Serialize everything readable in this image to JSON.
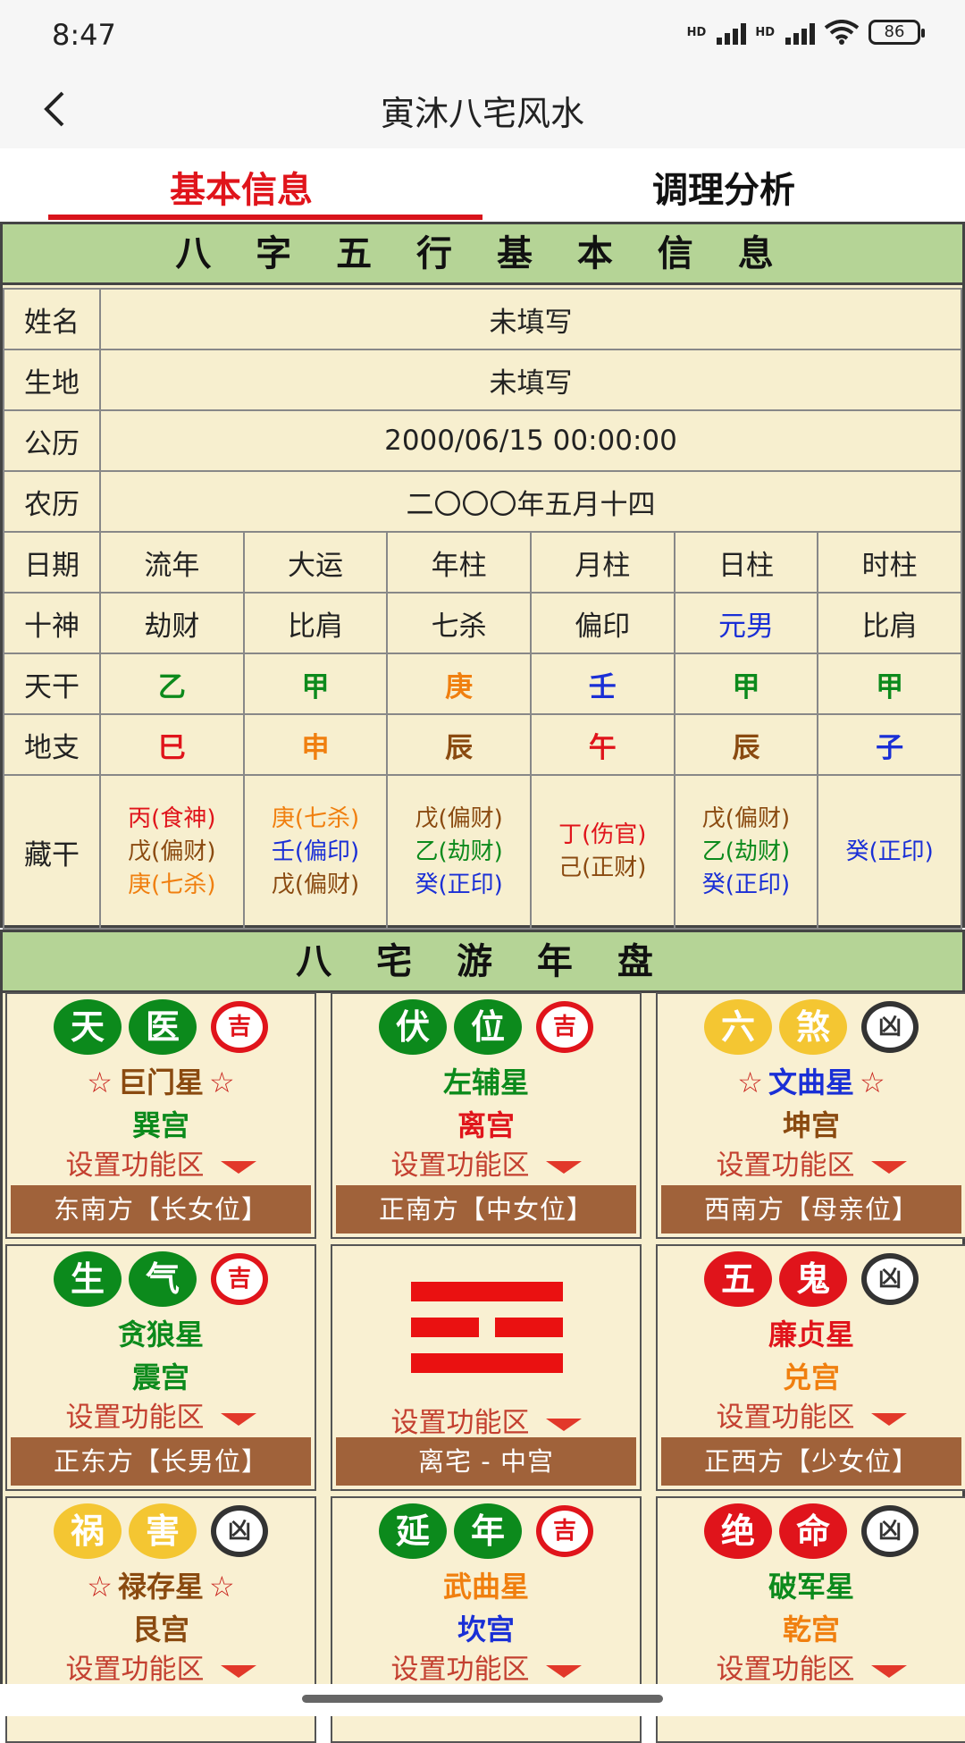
{
  "status": {
    "time": "8:47",
    "battery": "86",
    "sig1": "HD",
    "sig2": "HD"
  },
  "appbar": {
    "title": "寅沐八宅风水"
  },
  "tabs": [
    "基本信息",
    "调理分析"
  ],
  "bazi": {
    "heading": "八 字 五 行 基 本 信 息",
    "name_label": "姓名",
    "name_value": "未填写",
    "birthplace_label": "生地",
    "birthplace_value": "未填写",
    "solar_label": "公历",
    "solar_value": "2000/06/15 00:00:00",
    "lunar_label": "农历",
    "lunar_value": "二〇〇〇年五月十四",
    "rows": {
      "date": {
        "label": "日期",
        "cells": [
          "流年",
          "大运",
          "年柱",
          "月柱",
          "日柱",
          "时柱"
        ]
      },
      "shishen": {
        "label": "十神",
        "cells": [
          {
            "t": "劫财",
            "c": "#222"
          },
          {
            "t": "比肩",
            "c": "#222"
          },
          {
            "t": "七杀",
            "c": "#222"
          },
          {
            "t": "偏印",
            "c": "#222"
          },
          {
            "t": "元男",
            "c": "#1a2fd6"
          },
          {
            "t": "比肩",
            "c": "#222"
          }
        ]
      },
      "tiangan": {
        "label": "天干",
        "cells": [
          {
            "t": "乙",
            "c": "#0c8a1c"
          },
          {
            "t": "甲",
            "c": "#0c8a1c"
          },
          {
            "t": "庚",
            "c": "#f07f0f"
          },
          {
            "t": "壬",
            "c": "#1a2fd6"
          },
          {
            "t": "甲",
            "c": "#0c8a1c"
          },
          {
            "t": "甲",
            "c": "#0c8a1c"
          }
        ]
      },
      "dizhi": {
        "label": "地支",
        "cells": [
          {
            "t": "巳",
            "c": "#e0141b"
          },
          {
            "t": "申",
            "c": "#f07f0f"
          },
          {
            "t": "辰",
            "c": "#8a4a10"
          },
          {
            "t": "午",
            "c": "#e0141b"
          },
          {
            "t": "辰",
            "c": "#8a4a10"
          },
          {
            "t": "子",
            "c": "#1a2fd6"
          }
        ]
      },
      "canggan": {
        "label": "藏干",
        "cells": [
          [
            {
              "t": "丙(食神)",
              "c": "#e0141b"
            },
            {
              "t": "戊(偏财)",
              "c": "#8a4a10"
            },
            {
              "t": "庚(七杀)",
              "c": "#f07f0f"
            }
          ],
          [
            {
              "t": "庚(七杀)",
              "c": "#f07f0f"
            },
            {
              "t": "壬(偏印)",
              "c": "#1a2fd6"
            },
            {
              "t": "戊(偏财)",
              "c": "#8a4a10"
            }
          ],
          [
            {
              "t": "戊(偏财)",
              "c": "#8a4a10"
            },
            {
              "t": "乙(劫财)",
              "c": "#0c8a1c"
            },
            {
              "t": "癸(正印)",
              "c": "#1a2fd6"
            }
          ],
          [
            {
              "t": "丁(伤官)",
              "c": "#e0141b"
            },
            {
              "t": "己(正财)",
              "c": "#8a4a10"
            }
          ],
          [
            {
              "t": "戊(偏财)",
              "c": "#8a4a10"
            },
            {
              "t": "乙(劫财)",
              "c": "#0c8a1c"
            },
            {
              "t": "癸(正印)",
              "c": "#1a2fd6"
            }
          ],
          [
            {
              "t": "癸(正印)",
              "c": "#1a2fd6"
            }
          ]
        ]
      }
    }
  },
  "bazhai": {
    "heading": "八 宅 游 年 盘",
    "set_label": "设置功能区",
    "center": {
      "set_label": "设置功能区",
      "dir": "离宅 - 中宫"
    },
    "cells": [
      {
        "b1": "天",
        "b2": "医",
        "bc": "#0c8a1c",
        "fort": "吉",
        "fc": "#e0141b",
        "star": "巨门星",
        "sc": "#8a4a10",
        "stars": true,
        "palace": "巽宫",
        "pc": "#0c8a1c",
        "dir": "东南方【长女位】"
      },
      {
        "b1": "伏",
        "b2": "位",
        "bc": "#0c8a1c",
        "fort": "吉",
        "fc": "#e0141b",
        "star": "左辅星",
        "sc": "#0c8a1c",
        "stars": false,
        "palace": "离宫",
        "pc": "#e0141b",
        "dir": "正南方【中女位】"
      },
      {
        "b1": "六",
        "b2": "煞",
        "bc": "#f4c632",
        "fort": "凶",
        "fc": "#333",
        "star": "文曲星",
        "sc": "#1a2fd6",
        "stars": true,
        "palace": "坤宫",
        "pc": "#8a4a10",
        "dir": "西南方【母亲位】"
      },
      {
        "b1": "生",
        "b2": "气",
        "bc": "#0c8a1c",
        "fort": "吉",
        "fc": "#e0141b",
        "star": "贪狼星",
        "sc": "#0c8a1c",
        "stars": false,
        "palace": "震宫",
        "pc": "#0c8a1c",
        "dir": "正东方【长男位】"
      },
      {
        "b1": "五",
        "b2": "鬼",
        "bc": "#e0141b",
        "fort": "凶",
        "fc": "#333",
        "star": "廉贞星",
        "sc": "#e0141b",
        "stars": false,
        "palace": "兑宫",
        "pc": "#f07f0f",
        "dir": "正西方【少女位】"
      },
      {
        "b1": "祸",
        "b2": "害",
        "bc": "#f4c632",
        "fort": "凶",
        "fc": "#333",
        "star": "禄存星",
        "sc": "#8a4a10",
        "stars": true,
        "palace": "艮宫",
        "pc": "#8a4a10",
        "dir": ""
      },
      {
        "b1": "延",
        "b2": "年",
        "bc": "#0c8a1c",
        "fort": "吉",
        "fc": "#e0141b",
        "star": "武曲星",
        "sc": "#f07f0f",
        "stars": false,
        "palace": "坎宫",
        "pc": "#1a2fd6",
        "dir": ""
      },
      {
        "b1": "绝",
        "b2": "命",
        "bc": "#e0141b",
        "fort": "凶",
        "fc": "#333",
        "star": "破军星",
        "sc": "#0c8a1c",
        "stars": false,
        "palace": "乾宫",
        "pc": "#f07f0f",
        "dir": ""
      }
    ]
  }
}
